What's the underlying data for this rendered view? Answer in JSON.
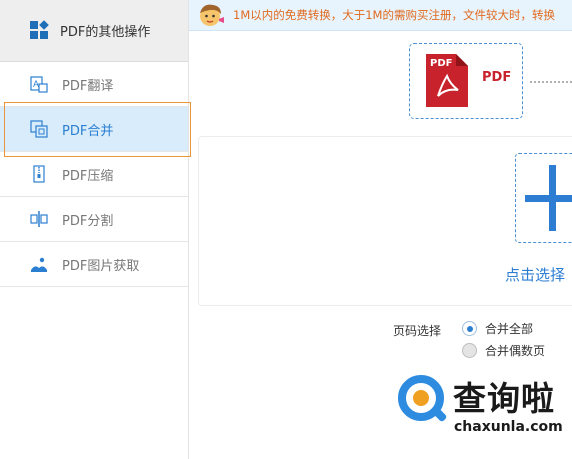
{
  "sidebar": {
    "header_title": "PDF的其他操作",
    "items": [
      {
        "label": "PDF翻译",
        "icon": "translate-icon"
      },
      {
        "label": "PDF合并",
        "icon": "merge-icon",
        "active": true
      },
      {
        "label": "PDF压缩",
        "icon": "compress-icon"
      },
      {
        "label": "PDF分割",
        "icon": "split-icon"
      },
      {
        "label": "PDF图片获取",
        "icon": "image-extract-icon"
      }
    ]
  },
  "notice": {
    "text": "1M以内的免费转换，大于1M的需购买注册，文件较大时，转换"
  },
  "pdf_badge": {
    "doc_label": "PDF",
    "label": "PDF"
  },
  "upload": {
    "click_select": "点击选择"
  },
  "page_selection": {
    "label": "页码选择",
    "options": [
      {
        "label": "合并全部",
        "checked": true
      },
      {
        "label": "合并偶数页",
        "checked": false
      }
    ]
  },
  "watermark": {
    "title": "查询啦",
    "url": "chaxunla.com"
  },
  "colors": {
    "accent": "#2d7ed3",
    "active_bg": "#d8ecfb",
    "notice_text": "#e06a1f",
    "pdf_red": "#c8232c"
  }
}
